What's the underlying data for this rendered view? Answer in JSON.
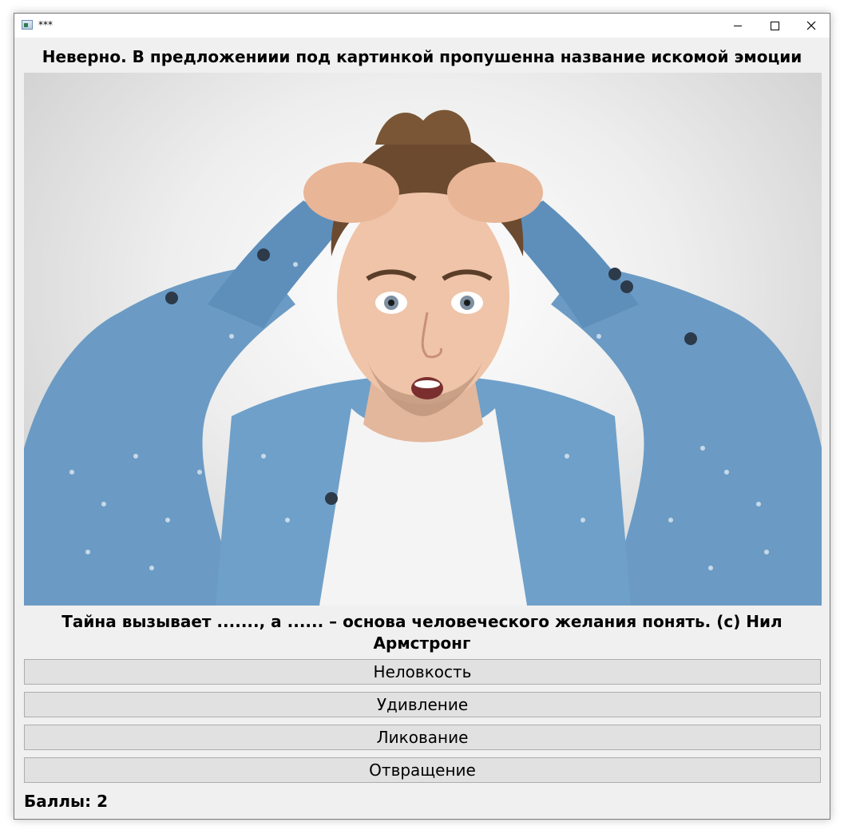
{
  "window": {
    "title": "***"
  },
  "feedback": {
    "message": "Неверно. В предложениии под картинкой пропушенна название искомой эмоции"
  },
  "question": {
    "quote": "Тайна вызывает ......., а ...... – основа человеческого желания понять. (с) Нил Армстронг"
  },
  "options": [
    {
      "label": "Неловкость"
    },
    {
      "label": "Удивление"
    },
    {
      "label": "Ликование"
    },
    {
      "label": "Отвращение"
    }
  ],
  "score": {
    "text": "Баллы: 2"
  },
  "colors": {
    "shirt": "#6b9bc4",
    "button_face": "#e1e1e1",
    "window_bg": "#f0f0f0"
  }
}
